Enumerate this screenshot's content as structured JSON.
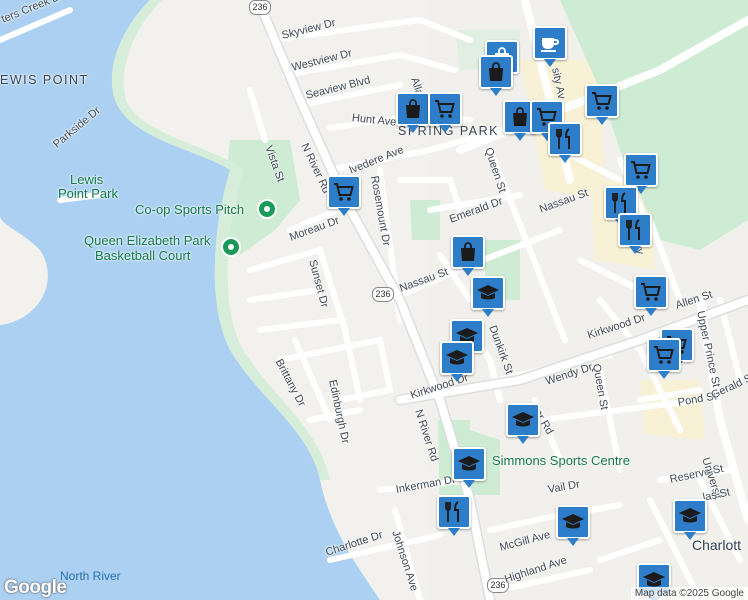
{
  "map": {
    "places": {
      "lewis_point": "EWIS POINT",
      "spring_park": "SPRING PARK",
      "charlottetown": "Charlott"
    },
    "parks": {
      "lewis_point_park_1": "Lewis",
      "lewis_point_park_2": "Point Park",
      "coop_sports_pitch": "Co-op Sports Pitch",
      "queen_elizabeth_park_1": "Queen Elizabeth Park",
      "queen_elizabeth_park_2": "Basketball Court",
      "simmons_sports_centre": "Simmons Sports Centre"
    },
    "water": {
      "north_river": "North River"
    },
    "streets": {
      "creek_dr": "ters Creek Dr",
      "skyview_dr": "Skyview Dr",
      "westview_dr": "Westview Dr",
      "seaview_blvd": "Seaview Blvd",
      "hunt_ave": "Hunt Ave",
      "allan": "Allan",
      "parkside_dr": "Parkside Dr",
      "vista_st": "Vista St",
      "n_river_rd_1": "N River Rd",
      "n_river_rd_2": "N River Rd",
      "belvedere_ave": "lvedere Ave",
      "queen_st_1": "Queen St",
      "queen_st_2": "Queen St",
      "rosemount_dr": "Rosemount Dr",
      "moreau_dr": "Moreau Dr",
      "emerald_dr": "Emerald Dr",
      "nassau_st_1": "Nassau St",
      "nassau_st_2": "Nassau St",
      "sunset_dr": "Sunset Dr",
      "dunkirk_st": "Dunkirk St",
      "kirkwood_dr_1": "Kirkwood Dr",
      "kirkwood_dr_2": "Kirkwood Dr",
      "allen_st": "Allen St",
      "upper_prince_st": "Upper Prince St",
      "brittany_dr": "Brittany Dr",
      "edinburgh_dr": "Edinburgh Dr",
      "wendy_dr": "Wendy Dr",
      "spring_rd": "Spr    Rd",
      "pond_st": "Pond St",
      "gerald_st": "Gerald St",
      "inkerman_dr": "Inkerman Dr",
      "reserve_st": "Reserve St",
      "university": "Universit",
      "vail_dr": "Vail Dr",
      "las_st": "las St",
      "charlotte_dr": "Charlotte Dr",
      "johnson_ave": "Johnson Ave",
      "mcgill_ave": "McGill Ave",
      "highland_ave": "Highland Ave",
      "sity": "sity",
      "sity_ave": "sity Av"
    },
    "route_shield": "236",
    "google_logo": "Google",
    "attribution": "Map data ©2025 Google",
    "colors": {
      "water": "#abd0f2",
      "park": "#cdecd3",
      "poi_marker": "#2d7dc8",
      "green_pin": "#1a9a5a"
    },
    "poi_icons": [
      "shopping-cart-icon",
      "shopping-bag-icon",
      "restaurant-icon",
      "school-icon",
      "cafe-icon"
    ]
  }
}
